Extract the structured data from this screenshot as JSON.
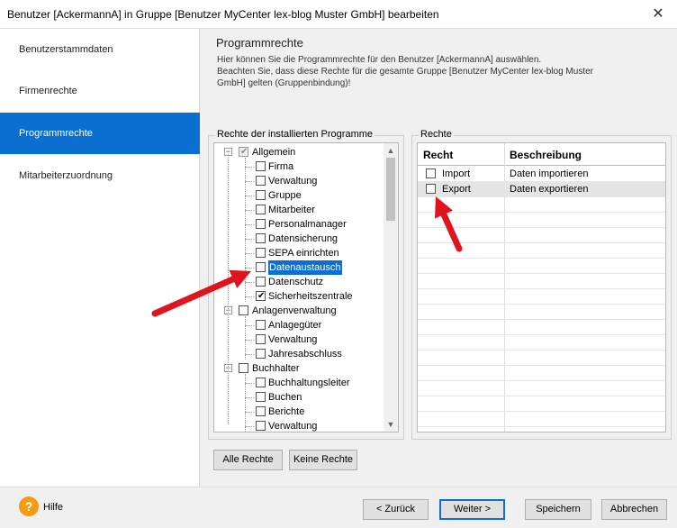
{
  "window": {
    "title": "Benutzer [AckermannA] in Gruppe [Benutzer MyCenter lex-blog Muster GmbH] bearbeiten",
    "close_glyph": "✕"
  },
  "sidebar": {
    "items": [
      {
        "label": "Benutzerstammdaten",
        "active": false
      },
      {
        "label": "Firmenrechte",
        "active": false
      },
      {
        "label": "Programmrechte",
        "active": true
      },
      {
        "label": "Mitarbeiterzuordnung",
        "active": false
      }
    ]
  },
  "main": {
    "heading": "Programmrechte",
    "description_lines": [
      "Hier können Sie die Programmrechte für den Benutzer [AckermannA] auswählen.",
      "Beachten Sie, dass diese Rechte für die gesamte Gruppe [Benutzer MyCenter lex-blog Muster",
      "GmbH] gelten (Gruppenbindung)!"
    ],
    "programs_group_label": "Rechte der installierten Programme",
    "rights_group_label": "Rechte",
    "tree": [
      {
        "label": "Allgemein",
        "level": 0,
        "expanded": true,
        "state": "grey"
      },
      {
        "label": "Firma",
        "level": 1,
        "state": "unchecked"
      },
      {
        "label": "Verwaltung",
        "level": 1,
        "state": "unchecked"
      },
      {
        "label": "Gruppe",
        "level": 1,
        "state": "unchecked"
      },
      {
        "label": "Mitarbeiter",
        "level": 1,
        "state": "unchecked"
      },
      {
        "label": "Personalmanager",
        "level": 1,
        "state": "unchecked"
      },
      {
        "label": "Datensicherung",
        "level": 1,
        "state": "unchecked"
      },
      {
        "label": "SEPA einrichten",
        "level": 1,
        "state": "unchecked"
      },
      {
        "label": "Datenaustausch",
        "level": 1,
        "state": "unchecked",
        "selected": true
      },
      {
        "label": "Datenschutz",
        "level": 1,
        "state": "unchecked"
      },
      {
        "label": "Sicherheitszentrale",
        "level": 1,
        "state": "checked"
      },
      {
        "label": "Anlagenverwaltung",
        "level": 0,
        "expanded": true,
        "state": "unchecked"
      },
      {
        "label": "Anlagegüter",
        "level": 1,
        "state": "unchecked"
      },
      {
        "label": "Verwaltung",
        "level": 1,
        "state": "unchecked"
      },
      {
        "label": "Jahresabschluss",
        "level": 1,
        "state": "unchecked"
      },
      {
        "label": "Buchhalter",
        "level": 0,
        "expanded": true,
        "state": "unchecked"
      },
      {
        "label": "Buchhaltungsleiter",
        "level": 1,
        "state": "unchecked"
      },
      {
        "label": "Buchen",
        "level": 1,
        "state": "unchecked"
      },
      {
        "label": "Berichte",
        "level": 1,
        "state": "unchecked"
      },
      {
        "label": "Verwaltung",
        "level": 1,
        "state": "unchecked"
      }
    ],
    "rights_table": {
      "columns": [
        "Recht",
        "Beschreibung"
      ],
      "rows": [
        {
          "recht": "Import",
          "beschreibung": "Daten importieren",
          "checked": false
        },
        {
          "recht": "Export",
          "beschreibung": "Daten exportieren",
          "checked": false
        }
      ]
    },
    "buttons": {
      "all_rights": "Alle Rechte",
      "no_rights": "Keine Rechte"
    }
  },
  "footer": {
    "help_label": "Hilfe",
    "help_glyph": "?",
    "back": "< Zurück",
    "next": "Weiter >",
    "save": "Speichern",
    "cancel": "Abbrechen"
  },
  "annotation_color": "#e0141e"
}
